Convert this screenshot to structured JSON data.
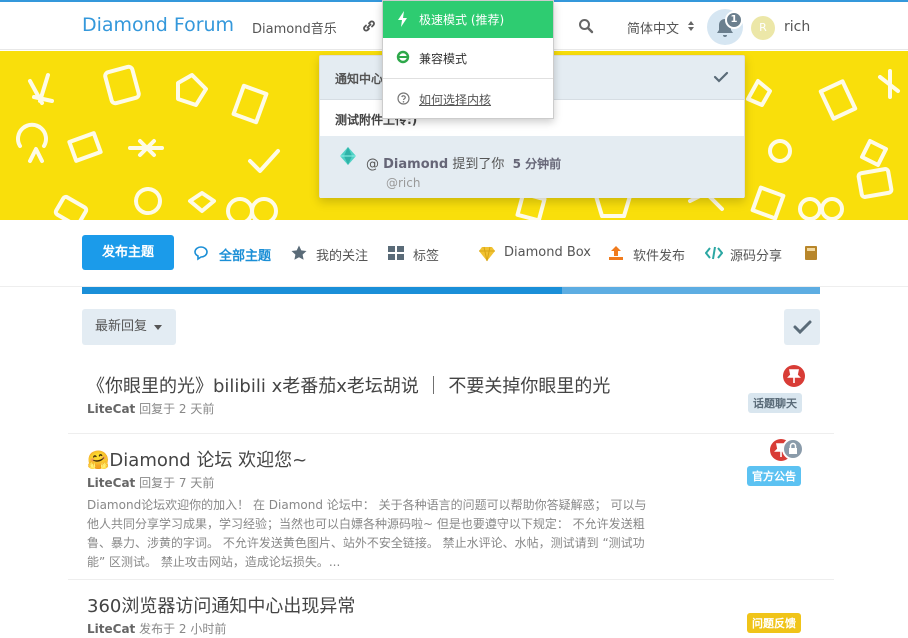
{
  "header": {
    "brand": "Diamond Forum",
    "nav_music": "Diamond音乐",
    "language": "简体中文",
    "notification_count": "1",
    "avatar_letter": "R",
    "username": "rich"
  },
  "browser_mode_menu": {
    "fast_mode": "极速模式 (推荐)",
    "compat_mode": "兼容模式",
    "help_link": "如何选择内核"
  },
  "notifications": {
    "title": "通知中心",
    "discussion_title": "测试附件上传:)",
    "item_user": "Diamond",
    "item_action": "提到了你",
    "item_time": "5 分钟前",
    "item_handle": "@rich"
  },
  "toolbar": {
    "new_topic": "发布主题",
    "all_topics": "全部主题",
    "following": "我的关注",
    "tags": "标签",
    "diamond_box": "Diamond Box",
    "software": "软件发布",
    "source_code": "源码分享"
  },
  "progress": {
    "value_percent": 65
  },
  "sort": {
    "label": "最新回复"
  },
  "discussions": [
    {
      "title": "《你眼里的光》bilibili x老番茄x老坛胡说 ｜ 不要关掉你眼里的光",
      "author": "LiteCat",
      "meta": "回复于 2 天前",
      "tag": "话题聊天",
      "tag_color": "#d9e6ef"
    },
    {
      "title": "Diamond 论坛 欢迎您~",
      "emoji": "🤗",
      "author": "LiteCat",
      "meta": "回复于 7 天前",
      "tag": "官方公告",
      "tag_color": "#5cc2f2",
      "excerpt": "Diamond论坛欢迎你的加入！ 在 Diamond 论坛中： 关于各种语言的问题可以帮助你答疑解惑； 可以与他人共同分享学习成果，学习经验；当然也可以白嫖各种源码啦~ 但是也要遵守以下规定： 不允许发送粗鲁、暴力、涉黄的字词。 不允许发送黄色图片、站外不安全链接。 禁止水评论、水帖，测试请到 “测试功能” 区测试。 禁止攻击网站，造成论坛损失。..."
    },
    {
      "title": "360浏览器访问通知中心出现异常",
      "author": "LiteCat",
      "meta": "发布于 2 小时前",
      "tag": "问题反馈",
      "tag_color": "#f0c419"
    }
  ],
  "colors": {
    "accent": "#3498db",
    "hero": "#f9df0b",
    "primary_button": "#1b9bea",
    "mode_green": "#2ecc71",
    "pin_red": "#d83c36"
  }
}
